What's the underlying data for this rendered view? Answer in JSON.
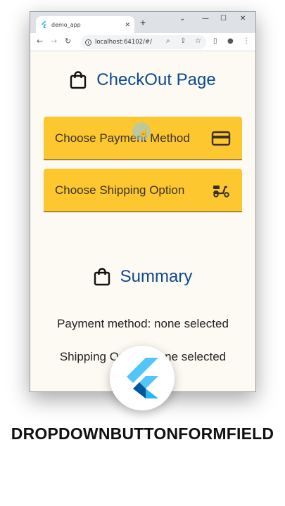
{
  "browser": {
    "tab_title": "demo_app",
    "tab_close": "✕",
    "new_tab": "+",
    "url": "localhost:64102/#/",
    "controls": {
      "minimize": "⌄",
      "min": "—",
      "max": "☐",
      "close": "✕"
    }
  },
  "page": {
    "title": "CheckOut Page",
    "payment_dropdown": {
      "label": "Choose Payment Method",
      "icon": "credit-card-icon"
    },
    "shipping_dropdown": {
      "label": "Choose Shipping Option",
      "icon": "scooter-icon"
    },
    "summary_title": "Summary",
    "payment_summary": "Payment method: none selected",
    "shipping_summary": "Shipping Option: none selected"
  },
  "caption": "DROPDOWNBUTTONFORMFIELD",
  "colors": {
    "heading": "#0d4a8c",
    "dropdown_fill": "#fdc72f",
    "page_bg": "#fdf9f3",
    "flutter_light": "#54c5f8",
    "flutter_dark": "#01579b"
  }
}
